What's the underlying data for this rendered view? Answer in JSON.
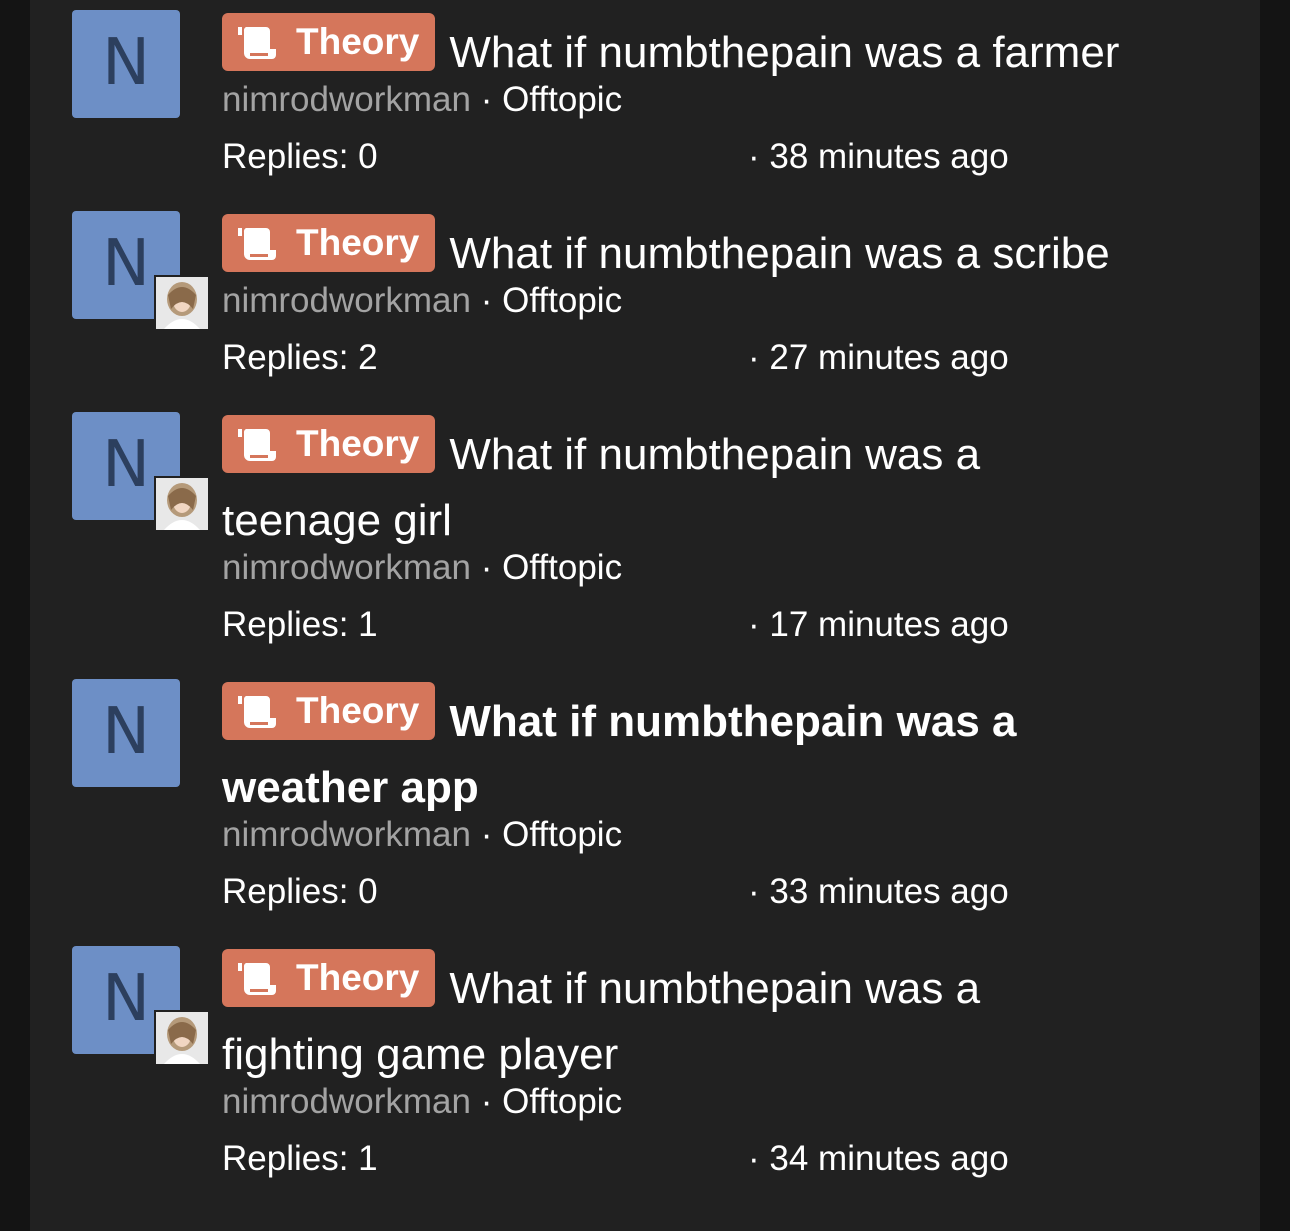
{
  "threads": [
    {
      "avatar_letter": "N",
      "has_last_poster_avatar": false,
      "prefix": "Theory",
      "title_line1": "What if numbthepain was a farmer",
      "title_line2": "",
      "bold": false,
      "author": "nimrodworkman",
      "separator": "·",
      "forum": "Offtopic",
      "replies": "Replies: 0",
      "time": "· 38 minutes ago"
    },
    {
      "avatar_letter": "N",
      "has_last_poster_avatar": true,
      "prefix": "Theory",
      "title_line1": "What if numbthepain was a scribe",
      "title_line2": "",
      "bold": false,
      "author": "nimrodworkman",
      "separator": "·",
      "forum": "Offtopic",
      "replies": "Replies: 2",
      "time": "· 27 minutes ago"
    },
    {
      "avatar_letter": "N",
      "has_last_poster_avatar": true,
      "prefix": "Theory",
      "title_line1": "What if numbthepain was a",
      "title_line2": "teenage girl",
      "bold": false,
      "author": "nimrodworkman",
      "separator": "·",
      "forum": "Offtopic",
      "replies": "Replies: 1",
      "time": "· 17 minutes ago"
    },
    {
      "avatar_letter": "N",
      "has_last_poster_avatar": false,
      "prefix": "Theory",
      "title_line1": "What if numbthepain was a",
      "title_line2": "weather app",
      "bold": true,
      "author": "nimrodworkman",
      "separator": "·",
      "forum": "Offtopic",
      "replies": "Replies: 0",
      "time": "· 33 minutes ago"
    },
    {
      "avatar_letter": "N",
      "has_last_poster_avatar": true,
      "prefix": "Theory",
      "title_line1": "What if numbthepain was a",
      "title_line2": "fighting game player",
      "bold": false,
      "author": "nimrodworkman",
      "separator": "·",
      "forum": "Offtopic",
      "replies": "Replies: 1",
      "time": "· 34 minutes ago"
    }
  ],
  "colors": {
    "background": "#212121",
    "avatar": "#6d8fc6",
    "prefix": "#d5765b",
    "muted_text": "#a3a3a3"
  },
  "icons": {
    "prefix_icon": "scroll-icon",
    "last_poster": "user-photo-avatar"
  }
}
